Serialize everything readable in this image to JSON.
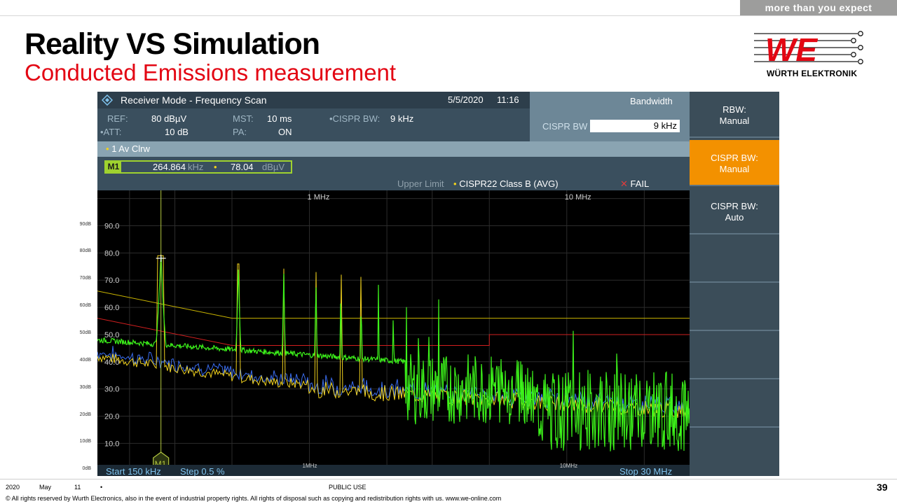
{
  "header": {
    "tagline": "more than you expect",
    "title": "Reality VS Simulation",
    "subtitle": "Conducted Emissions measurement",
    "logo_name": "WÜRTH ELEKTRONIK"
  },
  "analyzer": {
    "mode": "Receiver Mode - Frequency Scan",
    "date": "5/5/2020",
    "time": "11:16",
    "params": {
      "ref_label": "REF:",
      "ref_value": "80 dBµV",
      "att_label": "•ATT:",
      "att_value": "10 dB",
      "mst_label": "MST:",
      "mst_value": "10 ms",
      "pa_label": "PA:",
      "pa_value": "ON",
      "cispr_bw_label": "•CISPR BW:",
      "cispr_bw_value": "9 kHz"
    },
    "trace_label": "1 Av Clrw",
    "marker": {
      "name": "M1",
      "freq_value": "264.864",
      "freq_unit": "kHz",
      "level_value": "78.04",
      "level_unit": "dBµV"
    },
    "limit": {
      "label": "Upper Limit",
      "name": "CISPR22 Class B (AVG)",
      "status": "FAIL"
    },
    "bandwidth_panel": {
      "title": "Bandwidth",
      "field_label": "CISPR BW",
      "field_value": "9 kHz"
    },
    "softkeys": [
      {
        "line1": "RBW:",
        "line2": "Manual",
        "active": false
      },
      {
        "line1": "CISPR BW:",
        "line2": "Manual",
        "active": true
      },
      {
        "line1": "CISPR BW:",
        "line2": "Auto",
        "active": false
      }
    ],
    "freq_labels": [
      "1 MHz",
      "10 MHz"
    ],
    "bottom_freq_labels": [
      "1MHz",
      "10MHz"
    ],
    "start_label": "Start 150 kHz",
    "step_label": "Step 0.5 %",
    "stop_label": "Stop 30 MHz",
    "y_labels": [
      "90.0",
      "80.0",
      "70.0",
      "60.0",
      "50.0",
      "40.0",
      "30.0",
      "20.0",
      "10.0"
    ],
    "left_axis_labels": [
      "90dB",
      "80dB",
      "70dB",
      "60dB",
      "50dB",
      "40dB",
      "30dB",
      "20dB",
      "10dB",
      "0dB"
    ],
    "colors": {
      "measurement": "#3cf21a",
      "simulation": "#f1d21d",
      "secondary_trace": "#3a6df0",
      "limit_line": "#c9b400",
      "red_line": "#d21f1f"
    }
  },
  "footer": {
    "year": "2020",
    "month": "May",
    "day": "11",
    "bullet": "•",
    "classification": "PUBLIC USE",
    "copyright": "© All rights reserved by Wurth Electronics, also in the event of industrial property rights. All rights of disposal such as copying and redistribution rights with us. www.we-online.com",
    "page_number": "39"
  }
}
